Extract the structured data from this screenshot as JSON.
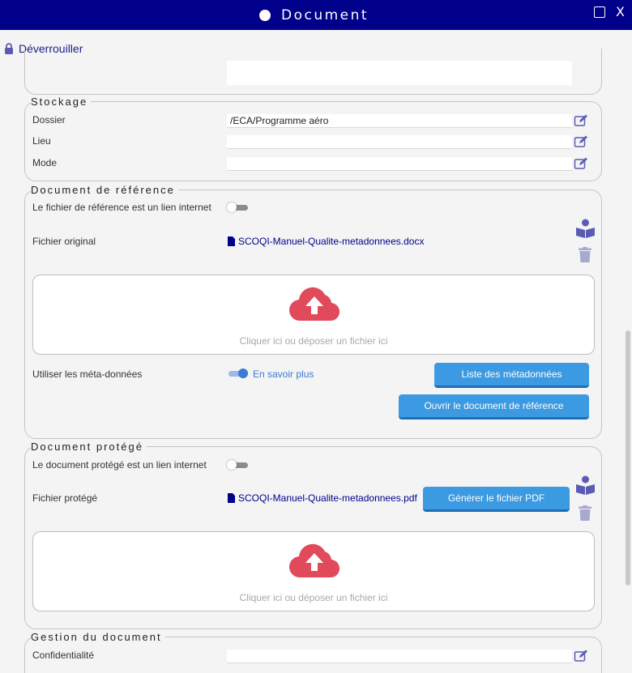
{
  "window": {
    "title": "Document"
  },
  "toolbar": {
    "unlock_label": "Déverrouiller"
  },
  "stockage": {
    "legend": "Stockage",
    "fields": [
      {
        "label": "Dossier",
        "value": "/ECA/Programme aéro"
      },
      {
        "label": "Lieu",
        "value": ""
      },
      {
        "label": "Mode",
        "value": ""
      }
    ]
  },
  "reference": {
    "legend": "Document de référence",
    "link_toggle_label": "Le fichier de référence est un lien internet",
    "link_toggle_on": false,
    "file_label": "Fichier original",
    "file_name": "SCOQI-Manuel-Qualite-metadonnees.docx",
    "dropzone_hint": "Cliquer ici ou déposer un fichier ici",
    "metadata_label": "Utiliser les méta-données",
    "metadata_on": true,
    "learn_more": "En savoir plus",
    "metadata_list_button": "Liste des métadonnées",
    "open_reference_button": "Ouvrir le document de référence"
  },
  "protected": {
    "legend": "Document protégé",
    "link_toggle_label": "Le document protégé est un lien internet",
    "link_toggle_on": false,
    "file_label": "Fichier protégé",
    "file_name": "SCOQI-Manuel-Qualite-metadonnees.pdf",
    "generate_pdf_button": "Générer le fichier PDF",
    "dropzone_hint": "Cliquer ici ou déposer un fichier ici"
  },
  "gestion": {
    "legend": "Gestion du document",
    "fields": [
      {
        "label": "Confidentialité",
        "value": ""
      }
    ]
  },
  "colors": {
    "title_bar": "#00008b",
    "button": "#3b9ae1",
    "upload_cloud": "#e04a5a",
    "icon": "#5b5bb5"
  }
}
